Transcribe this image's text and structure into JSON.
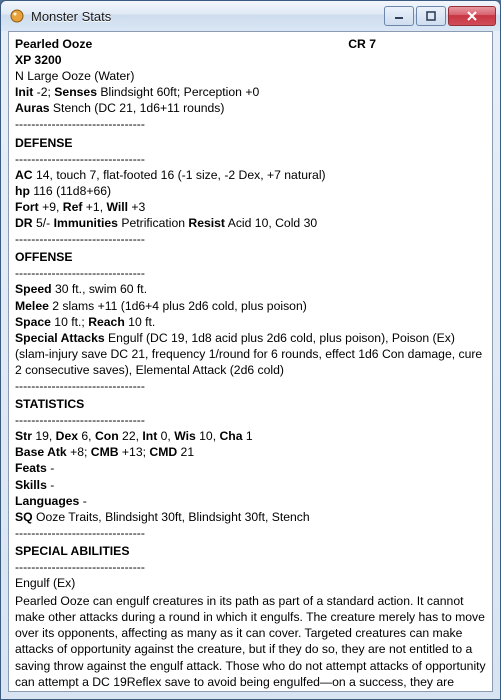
{
  "window": {
    "title": "Monster Stats"
  },
  "sep": "--------------------------------",
  "header": {
    "name": "Pearled Ooze",
    "cr": "CR 7",
    "xp": "XP 3200",
    "type_line": "N Large Ooze (Water)",
    "init_label": "Init",
    "init_val": " -2; ",
    "senses_label": "Senses",
    "senses_val": " Blindsight 60ft; Perception +0",
    "auras_label": "Auras",
    "auras_val": " Stench (DC 21, 1d6+11 rounds)"
  },
  "defense": {
    "title": "DEFENSE",
    "ac_label": "AC",
    "ac_val": " 14, touch 7, flat-footed 16 (-1 size, -2 Dex, +7 natural)",
    "hp_label": "hp",
    "hp_val": " 116 (11d8+66)",
    "fort_label": "Fort",
    "fort_val": " +9, ",
    "ref_label": "Ref",
    "ref_val": " +1, ",
    "will_label": "Will",
    "will_val": " +3",
    "dr_label": "DR",
    "dr_val": " 5/- ",
    "imm_label": "Immunities",
    "imm_val": " Petrification ",
    "res_label": "Resist",
    "res_val": " Acid 10, Cold 30"
  },
  "offense": {
    "title": "OFFENSE",
    "speed_label": "Speed",
    "speed_val": " 30 ft., swim 60 ft.",
    "melee_label": "Melee",
    "melee_val": " 2 slams +11 (1d6+4 plus 2d6 cold,  plus poison)",
    "space_label": "Space",
    "space_val": " 10 ft.; ",
    "reach_label": "Reach",
    "reach_val": " 10 ft.",
    "sa_label": "Special Attacks",
    "sa_val": " Engulf (DC 19, 1d8 acid plus 2d6 cold,  plus poison), Poison (Ex) (slam-injury save DC 21, frequency 1/round for 6 rounds, effect 1d6 Con damage, cure 2 consecutive saves), Elemental Attack (2d6 cold)"
  },
  "stats": {
    "title": "STATISTICS",
    "str_l": "Str",
    "str_v": " 19, ",
    "dex_l": "Dex",
    "dex_v": " 6, ",
    "con_l": "Con",
    "con_v": " 22, ",
    "int_l": "Int",
    "int_v": " 0, ",
    "wis_l": "Wis",
    "wis_v": " 10, ",
    "cha_l": "Cha",
    "cha_v": " 1",
    "bab_l": "Base Atk",
    "bab_v": " +8; ",
    "cmb_l": "CMB",
    "cmb_v": " +13; ",
    "cmd_l": "CMD",
    "cmd_v": " 21",
    "feats_l": "Feats",
    "feats_v": " -",
    "skills_l": "Skills",
    "skills_v": " -",
    "lang_l": "Languages",
    "lang_v": " -",
    "sq_l": "SQ",
    "sq_v": " Ooze Traits, Blindsight 30ft, Blindsight 30ft, Stench"
  },
  "abilities": {
    "title": "SPECIAL ABILITIES",
    "engulf_name": "Engulf (Ex)",
    "engulf_text": " Pearled Ooze can engulf creatures in its path as part of a standard action. It cannot make other attacks during a round in which it engulfs. The creature merely has to move over its opponents, affecting as many as it can cover. Targeted creatures can make attacks of opportunity against the creature, but if they do so, they are not entitled to a saving throw against the engulf attack. Those who do not attempt attacks of opportunity can attempt a DC 19Reflex save to avoid being engulfed—on a success, they are pushed back or aside (target's choice) as the creature moves"
  }
}
